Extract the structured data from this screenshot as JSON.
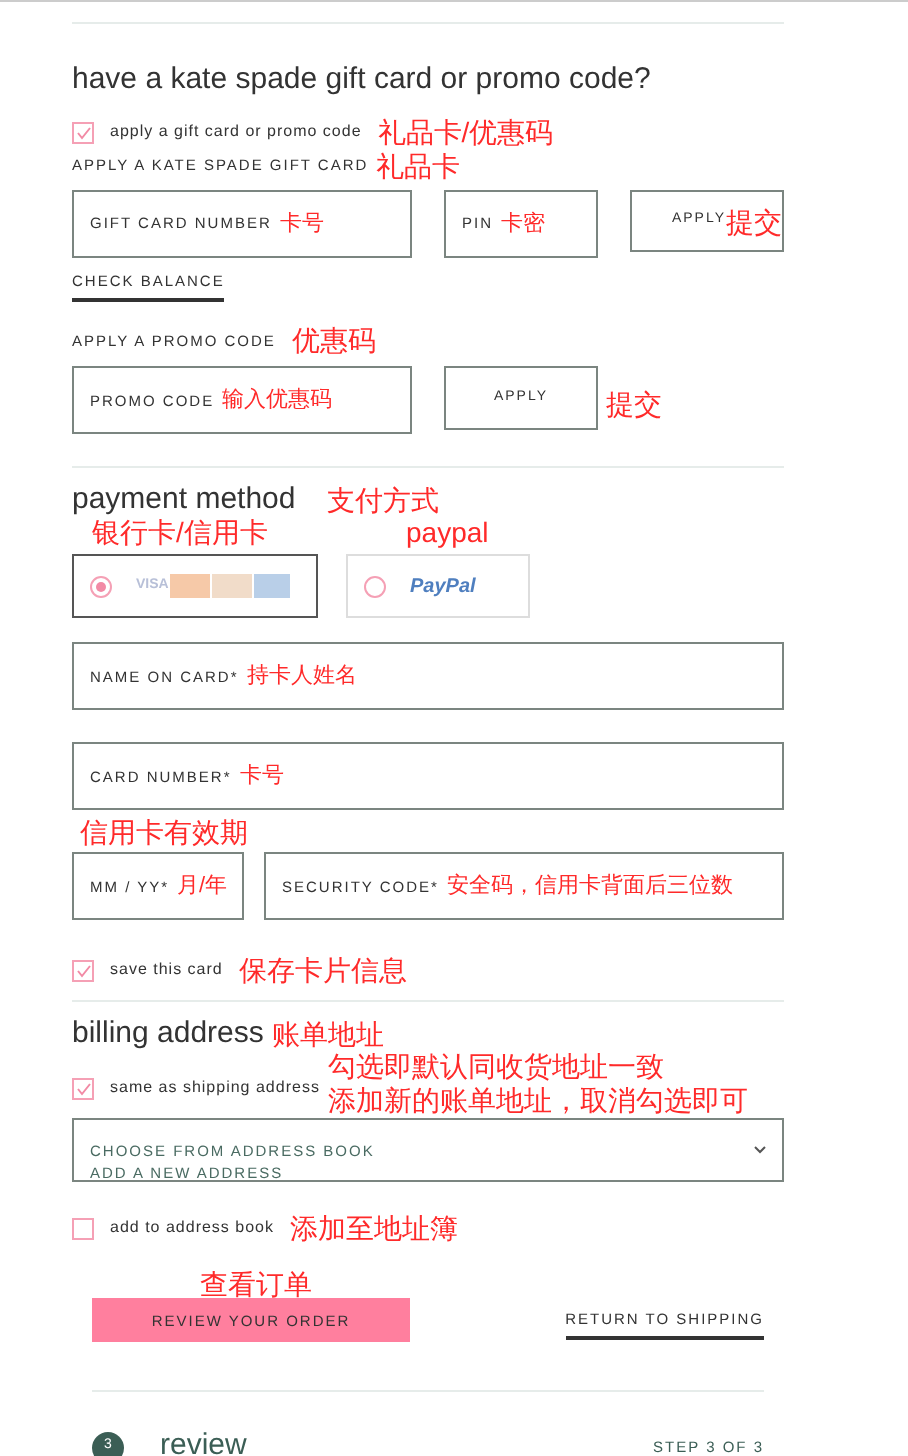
{
  "gift_section": {
    "title": "have a kate spade gift card or promo code?",
    "apply_checkbox": {
      "label": "apply a gift card or promo code",
      "checked": true,
      "note": "礼品卡/优惠码"
    },
    "gift_card": {
      "heading": "APPLY A KATE SPADE GIFT CARD",
      "note": "礼品卡",
      "number_field": {
        "placeholder": "GIFT CARD NUMBER",
        "note": "卡号"
      },
      "pin_field": {
        "placeholder": "PIN",
        "note": "卡密"
      },
      "apply_button": {
        "label": "APPLY",
        "note": "提交"
      },
      "check_balance": "CHECK BALANCE"
    },
    "promo": {
      "heading": "APPLY A PROMO CODE",
      "note": "优惠码",
      "field": {
        "placeholder": "PROMO CODE",
        "note": "输入优惠码"
      },
      "apply_button": {
        "label": "APPLY",
        "note": "提交"
      }
    }
  },
  "payment": {
    "title": "payment method",
    "note": "支付方式",
    "options": [
      {
        "kind": "card",
        "selected": true,
        "note": "银行卡/信用卡",
        "logo": "VISA"
      },
      {
        "kind": "paypal",
        "selected": false,
        "note": "paypal",
        "logo": "PayPal"
      }
    ],
    "name_field": {
      "placeholder": "NAME ON CARD*",
      "note": "持卡人姓名"
    },
    "number_field": {
      "placeholder": "CARD NUMBER*",
      "note": "卡号"
    },
    "expiry_field": {
      "placeholder": "MM / YY*",
      "note": "月/年",
      "above_note": "信用卡有效期"
    },
    "security_field": {
      "placeholder": "SECURITY CODE*",
      "note": "安全码，信用卡背面后三位数"
    },
    "save_checkbox": {
      "label": "save this card",
      "checked": true,
      "note": "保存卡片信息"
    }
  },
  "billing": {
    "title": "billing address",
    "note": "账单地址",
    "same_checkbox": {
      "label": "same as shipping address",
      "checked": true,
      "notes": [
        "勾选即默认同收货地址一致",
        "添加新的账单地址，取消勾选即可"
      ]
    },
    "address_select": {
      "options": [
        "CHOOSE FROM ADDRESS BOOK",
        "ADD A NEW ADDRESS"
      ]
    },
    "add_checkbox": {
      "label": "add to address book",
      "checked": false,
      "note": "添加至地址簿"
    }
  },
  "actions": {
    "review_button": {
      "label": "REVIEW YOUR ORDER",
      "note": "查看订单"
    },
    "return_link": "RETURN TO SHIPPING"
  },
  "step": {
    "number": "3",
    "title": "review",
    "counter": "STEP 3 OF 3"
  }
}
